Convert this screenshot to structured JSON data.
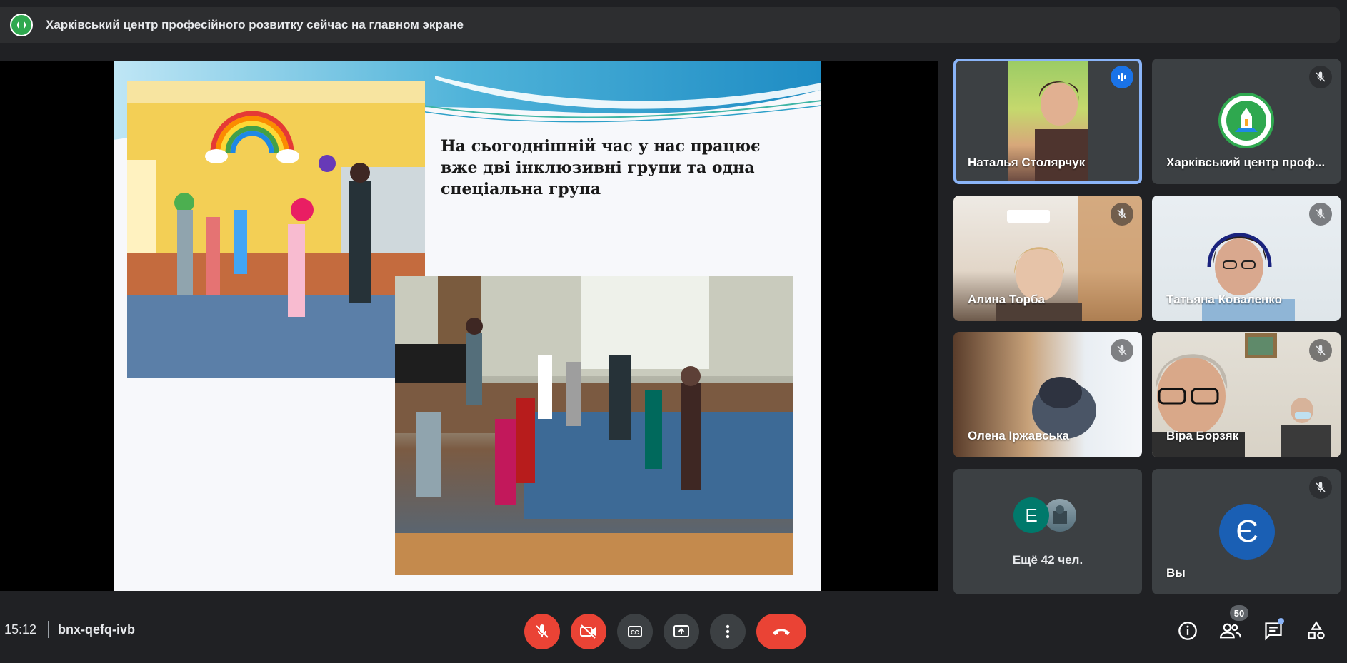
{
  "banner": {
    "text": "Харківський центр професійного розвитку сейчас на главном экране",
    "logo_icon": "college-logo-icon"
  },
  "slide": {
    "text": "На сьогоднішній час у нас працює вже дві інклюзивні групи та одна спеціальна група"
  },
  "participants": [
    {
      "name": "Наталья Столярчук",
      "state": "speaking",
      "video": true
    },
    {
      "name": "Харківський центр проф...",
      "state": "muted",
      "video": false,
      "avatar": "college-logo"
    },
    {
      "name": "Алина Торба",
      "state": "muted",
      "video": true
    },
    {
      "name": "Татьяна Коваленко",
      "state": "muted",
      "video": true
    },
    {
      "name": "Олена Іржавська",
      "state": "muted",
      "video": true
    },
    {
      "name": "Віра Борзяк",
      "state": "muted",
      "video": true
    }
  ],
  "others_tile": {
    "label": "Ещё 42 чел.",
    "avatar_letter": "E",
    "avatar_color": "#00796b"
  },
  "self_tile": {
    "label": "Вы",
    "avatar_letter": "Є",
    "avatar_color": "#1a5fb4"
  },
  "bottom": {
    "time": "15:12",
    "meeting_code": "bnx-qefq-ivb",
    "participants_count": "50",
    "controls": [
      "mic-off-icon",
      "camera-off-icon",
      "captions-icon",
      "present-icon",
      "more-icon",
      "end-call-icon"
    ],
    "right_icons": [
      "info-icon",
      "people-icon",
      "chat-icon",
      "activities-icon"
    ]
  },
  "colors": {
    "background": "#202124",
    "tile": "#3c4043",
    "danger": "#ea4335",
    "accent": "#8ab4f8",
    "speaking": "#1a73e8"
  }
}
